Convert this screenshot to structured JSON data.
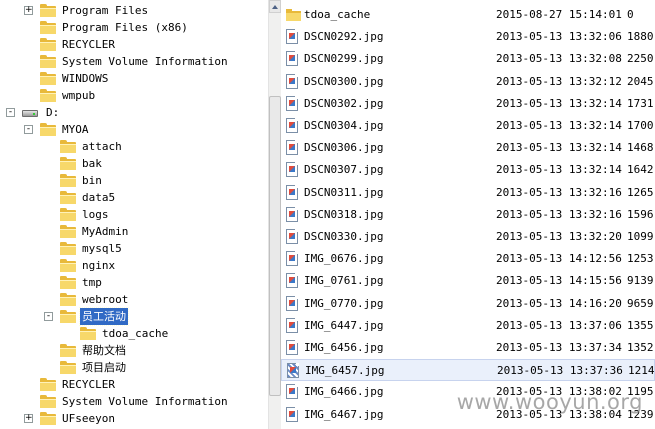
{
  "tree": {
    "items": [
      {
        "label": "Program Files",
        "level": 1,
        "expander": "+",
        "kind": "folder"
      },
      {
        "label": "Program Files (x86)",
        "level": 1,
        "expander": "",
        "kind": "folder"
      },
      {
        "label": "RECYCLER",
        "level": 1,
        "expander": "",
        "kind": "folder"
      },
      {
        "label": "System Volume Information",
        "level": 1,
        "expander": "",
        "kind": "folder"
      },
      {
        "label": "WINDOWS",
        "level": 1,
        "expander": "",
        "kind": "folder"
      },
      {
        "label": "wmpub",
        "level": 1,
        "expander": "",
        "kind": "folder"
      },
      {
        "label": "D:",
        "level": 0,
        "expander": "-",
        "kind": "drive"
      },
      {
        "label": "MYOA",
        "level": 1,
        "expander": "-",
        "kind": "folder-open"
      },
      {
        "label": "attach",
        "level": 2,
        "expander": "",
        "kind": "folder"
      },
      {
        "label": "bak",
        "level": 2,
        "expander": "",
        "kind": "folder"
      },
      {
        "label": "bin",
        "level": 2,
        "expander": "",
        "kind": "folder"
      },
      {
        "label": "data5",
        "level": 2,
        "expander": "",
        "kind": "folder"
      },
      {
        "label": "logs",
        "level": 2,
        "expander": "",
        "kind": "folder"
      },
      {
        "label": "MyAdmin",
        "level": 2,
        "expander": "",
        "kind": "folder"
      },
      {
        "label": "mysql5",
        "level": 2,
        "expander": "",
        "kind": "folder"
      },
      {
        "label": "nginx",
        "level": 2,
        "expander": "",
        "kind": "folder"
      },
      {
        "label": "tmp",
        "level": 2,
        "expander": "",
        "kind": "folder"
      },
      {
        "label": "webroot",
        "level": 2,
        "expander": "",
        "kind": "folder"
      },
      {
        "label": "员工活动",
        "level": 2,
        "expander": "-",
        "kind": "folder-open",
        "selected": true
      },
      {
        "label": "tdoa_cache",
        "level": 3,
        "expander": "",
        "kind": "folder"
      },
      {
        "label": "帮助文档",
        "level": 2,
        "expander": "",
        "kind": "folder"
      },
      {
        "label": "项目启动",
        "level": 2,
        "expander": "",
        "kind": "folder"
      },
      {
        "label": "RECYCLER",
        "level": 1,
        "expander": "",
        "kind": "folder"
      },
      {
        "label": "System Volume Information",
        "level": 1,
        "expander": "",
        "kind": "folder"
      },
      {
        "label": "UFseeyon",
        "level": 1,
        "expander": "+",
        "kind": "folder"
      }
    ]
  },
  "files": [
    {
      "name": "tdoa_cache",
      "date": "2015-08-27 15:14:01",
      "size": "0",
      "kind": "folder"
    },
    {
      "name": "DSCN0292.jpg",
      "date": "2013-05-13 13:32:06",
      "size": "1880",
      "kind": "image"
    },
    {
      "name": "DSCN0299.jpg",
      "date": "2013-05-13 13:32:08",
      "size": "2250",
      "kind": "image"
    },
    {
      "name": "DSCN0300.jpg",
      "date": "2013-05-13 13:32:12",
      "size": "2045",
      "kind": "image"
    },
    {
      "name": "DSCN0302.jpg",
      "date": "2013-05-13 13:32:14",
      "size": "1731",
      "kind": "image"
    },
    {
      "name": "DSCN0304.jpg",
      "date": "2013-05-13 13:32:14",
      "size": "1700",
      "kind": "image"
    },
    {
      "name": "DSCN0306.jpg",
      "date": "2013-05-13 13:32:14",
      "size": "1468",
      "kind": "image"
    },
    {
      "name": "DSCN0307.jpg",
      "date": "2013-05-13 13:32:14",
      "size": "1642",
      "kind": "image"
    },
    {
      "name": "DSCN0311.jpg",
      "date": "2013-05-13 13:32:16",
      "size": "1265",
      "kind": "image"
    },
    {
      "name": "DSCN0318.jpg",
      "date": "2013-05-13 13:32:16",
      "size": "1596",
      "kind": "image"
    },
    {
      "name": "DSCN0330.jpg",
      "date": "2013-05-13 13:32:20",
      "size": "1099",
      "kind": "image"
    },
    {
      "name": "IMG_0676.jpg",
      "date": "2013-05-13 14:12:56",
      "size": "1253",
      "kind": "image"
    },
    {
      "name": "IMG_0761.jpg",
      "date": "2013-05-13 14:15:56",
      "size": "9139",
      "kind": "image"
    },
    {
      "name": "IMG_0770.jpg",
      "date": "2013-05-13 14:16:20",
      "size": "9659",
      "kind": "image"
    },
    {
      "name": "IMG_6447.jpg",
      "date": "2013-05-13 13:37:06",
      "size": "1355",
      "kind": "image"
    },
    {
      "name": "IMG_6456.jpg",
      "date": "2013-05-13 13:37:34",
      "size": "1352",
      "kind": "image"
    },
    {
      "name": "IMG_6457.jpg",
      "date": "2013-05-13 13:37:36",
      "size": "1214",
      "kind": "image",
      "highlight": true
    },
    {
      "name": "IMG_6466.jpg",
      "date": "2013-05-13 13:38:02",
      "size": "1195",
      "kind": "image"
    },
    {
      "name": "IMG_6467.jpg",
      "date": "2013-05-13 13:38:04",
      "size": "1239",
      "kind": "image"
    }
  ],
  "watermark": "www.wooyun.org"
}
